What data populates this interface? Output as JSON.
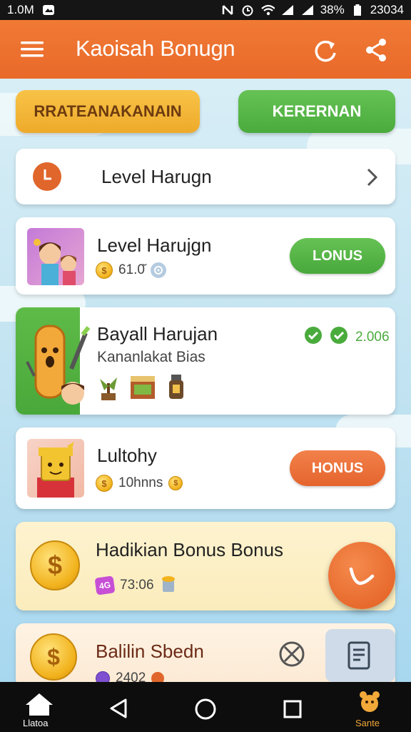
{
  "status_bar": {
    "left_text": "1.0M",
    "battery": "38%",
    "time": "23034"
  },
  "app_bar": {
    "title": "Kaoisah Bonugn",
    "icons": [
      "menu-icon",
      "refresh-icon",
      "share-icon"
    ]
  },
  "top_buttons": {
    "left_label": "RRATEANAKANAIN",
    "right_label": "KERERNAN"
  },
  "level_row": {
    "title": "Level Harugn",
    "icon": "clock-icon"
  },
  "cards": [
    {
      "title": "Level Harujgn",
      "value": "61.0̆",
      "button": "LONUS"
    },
    {
      "title": "Bayall Harujan",
      "subtitle": "Kananlakat Bias",
      "value": "2.006"
    },
    {
      "title": "Lultohy",
      "value": "10hnns",
      "button": "HONUS"
    },
    {
      "title": "Hadikian Bonus Bonus",
      "value": "73:06",
      "badge": "4G"
    },
    {
      "title": "Balilin Sbedn",
      "value": "2402"
    }
  ],
  "nav_bar": {
    "left_label": "Llatoa",
    "right_label": "Sante"
  },
  "colors": {
    "accent_orange": "#e9692a",
    "accent_green": "#4aab3d",
    "accent_yellow": "#eeaa2a"
  }
}
